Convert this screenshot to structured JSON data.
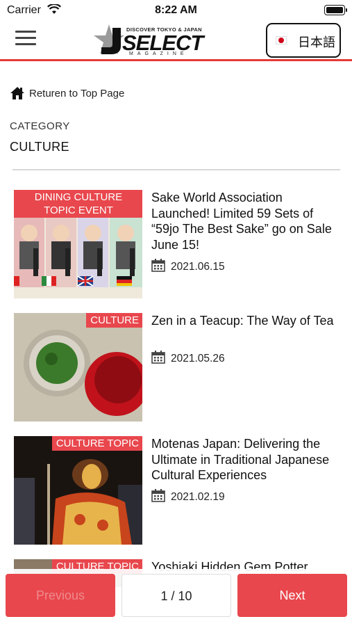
{
  "status_bar": {
    "carrier": "Carrier",
    "time": "8:22 AM"
  },
  "header": {
    "logo_kicker": "DISCOVER TOKYO & JAPAN",
    "logo_text": "SELECT",
    "logo_sub": "MAGAZINE",
    "language_label": "日本語"
  },
  "breadcrumb": {
    "label": "Returen to Top Page"
  },
  "category": {
    "label": "CATEGORY",
    "value": "CULTURE"
  },
  "articles": [
    {
      "tag_line1": "DINING CULTURE",
      "tag_line2": "TOPIC EVENT",
      "title": "Sake World Association Launched! Limited 59 Sets of “59jo The Best Sake” go on Sale June 15!",
      "date": "2021.06.15"
    },
    {
      "tag": "CULTURE",
      "title": "Zen in a Teacup: The Way of Tea",
      "date": "2021.05.26"
    },
    {
      "tag": "CULTURE TOPIC",
      "title": "Motenas Japan: Delivering the Ultimate in Traditional Japanese Cultural Experiences",
      "date": "2021.02.19"
    },
    {
      "tag": "CULTURE TOPIC",
      "title": "Yoshiaki Hidden Gem Potter"
    }
  ],
  "pager": {
    "previous_label": "Previous",
    "page_indicator": "1 / 10",
    "next_label": "Next"
  },
  "colors": {
    "accent": "#e8474d",
    "header_rule": "#e53935"
  }
}
